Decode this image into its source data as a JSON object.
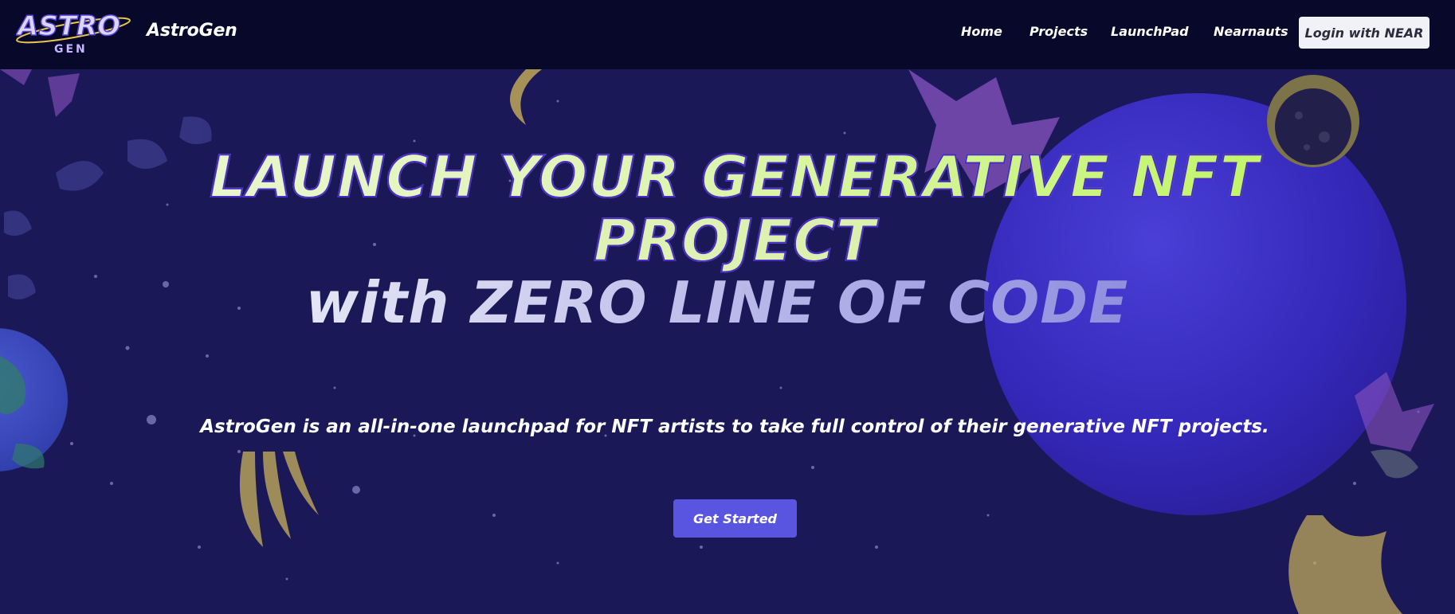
{
  "header": {
    "brand": "AstroGen",
    "nav": [
      {
        "label": "Home"
      },
      {
        "label": "Projects"
      },
      {
        "label": "LaunchPad"
      },
      {
        "label": "Nearnauts"
      }
    ],
    "login_label": "Login with NEAR"
  },
  "hero": {
    "line1": "LAUNCH YOUR GENERATIVE NFT",
    "line2": "PROJECT",
    "line3": "with ZERO LINE OF CODE",
    "tagline": "AstroGen is an all-in-one launchpad for NFT artists to take full control of their generative NFT projects.",
    "cta_label": "Get Started"
  },
  "logo": {
    "text_top": "ASTRO",
    "text_bottom": "GEN"
  },
  "colors": {
    "background": "#1b1858",
    "navbar": "#07082a",
    "cta": "#5a55e0",
    "headline_green": "#b7f550",
    "planet": "#3a2fc0"
  }
}
